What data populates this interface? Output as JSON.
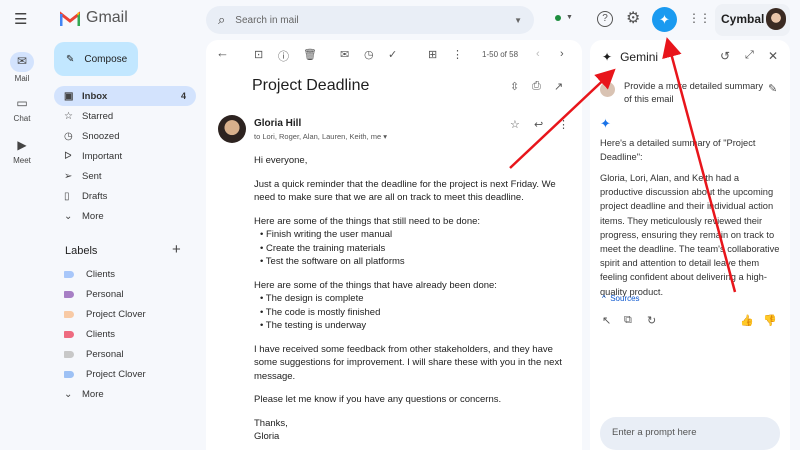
{
  "app": {
    "name": "Gmail",
    "brand": "Cymbal",
    "accent": "#0b57d0"
  },
  "search": {
    "placeholder": "Search in mail"
  },
  "rail": [
    {
      "label": "Mail"
    },
    {
      "label": "Chat"
    },
    {
      "label": "Meet"
    }
  ],
  "compose": "Compose",
  "folders": [
    {
      "label": "Inbox",
      "count": "4"
    },
    {
      "label": "Starred"
    },
    {
      "label": "Snoozed"
    },
    {
      "label": "Important"
    },
    {
      "label": "Sent"
    },
    {
      "label": "Drafts"
    },
    {
      "label": "More"
    }
  ],
  "labels": {
    "title": "Labels",
    "items": [
      {
        "label": "Clients",
        "color": "#a8c7fa"
      },
      {
        "label": "Personal",
        "color": "#a77fc5"
      },
      {
        "label": "Project Clover",
        "color": "#f8caa5"
      },
      {
        "label": "Clients",
        "color": "#ee6b80"
      },
      {
        "label": "Personal",
        "color": "#c8c8c8"
      },
      {
        "label": "Project Clover",
        "color": "#9dc1f5"
      }
    ],
    "more": "More"
  },
  "toolbar": {
    "pagination": "1-50 of 58"
  },
  "email": {
    "subject": "Project Deadline",
    "sender": "Gloria Hill",
    "recipients": "to Lori, Roger, Alan, Lauren, Keith, me",
    "greeting": "Hi everyone,",
    "p1": "Just a quick reminder that the deadline for the project is next Friday. We need to make sure that we are all on track to meet this deadline.",
    "p2": "Here are some of the things that still need to be done:",
    "todo": [
      "Finish writing the user manual",
      "Create the training materials",
      "Test the software on all platforms"
    ],
    "p3": "Here are some of the things that have already been done:",
    "done": [
      "The design is complete",
      "The code is mostly finished",
      "The testing is underway"
    ],
    "p4": "I have received some feedback from other stakeholders, and they have some suggestions for improvement. I will share these with you in the next message.",
    "p5": "Please let me know if you have any questions or concerns.",
    "signoff": "Thanks,",
    "signature": "Gloria"
  },
  "gemini": {
    "title": "Gemini",
    "user_prompt": "Provide a more detailed summary of this email",
    "intro": "Here's a detailed summary of \"Project Deadline\":",
    "summary": "Gloria, Lori, Alan, and Keith had a productive discussion about the upcoming project deadline and their individual action items. They meticulously reviewed their progress, ensuring they remain on track to meet the deadline. The team's collaborative spirit and attention to detail leave them feeling confident about delivering a high-quality product.",
    "sources": "Sources",
    "input_placeholder": "Enter a prompt here"
  }
}
